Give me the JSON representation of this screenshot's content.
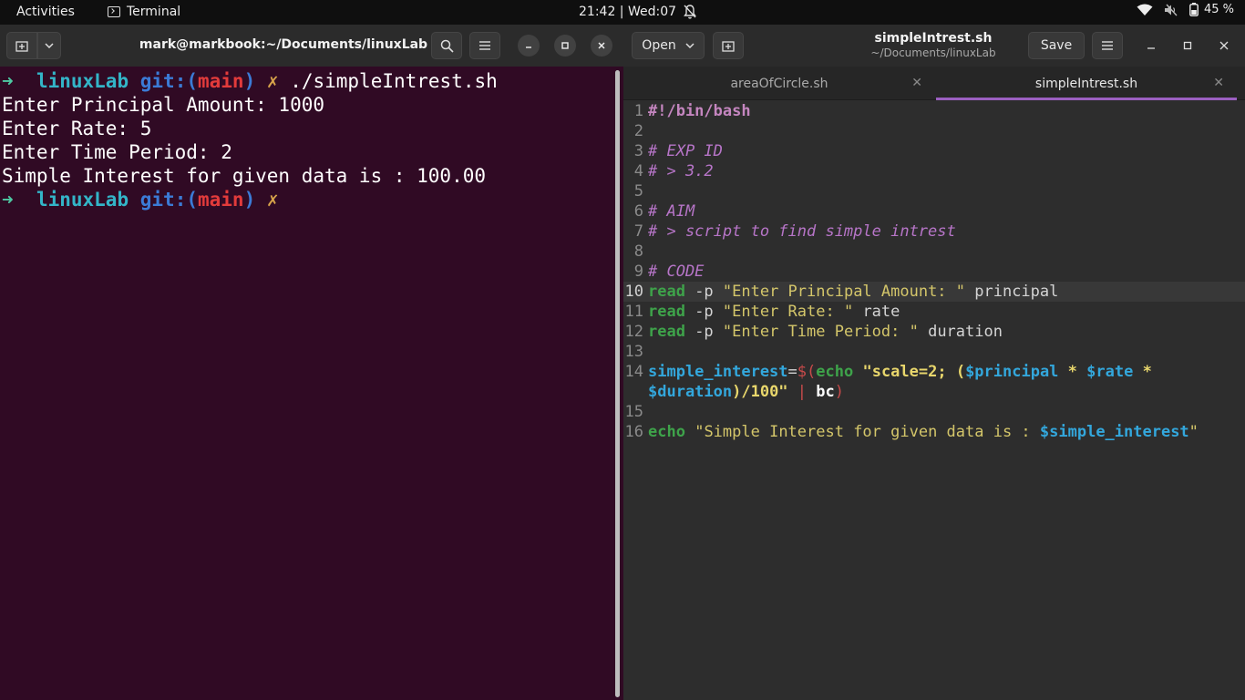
{
  "topbar": {
    "activities": "Activities",
    "app_name": "Terminal",
    "clock": "21:42 | Wed:07",
    "battery": "45 %"
  },
  "terminal": {
    "title": "mark@markbook:~/Documents/linuxLab",
    "prompt": {
      "arrow": "➜",
      "dir": "linuxLab",
      "git_prefix": "git:(",
      "branch": "main",
      "git_suffix": ")",
      "dirty": "✗"
    },
    "command": "./simpleIntrest.sh",
    "output": [
      "Enter Principal Amount: 1000",
      "Enter Rate: 5",
      "Enter Time Period: 2",
      "Simple Interest for given data is : 100.00"
    ]
  },
  "editor": {
    "open_label": "Open",
    "save_label": "Save",
    "title": "simpleIntrest.sh",
    "subtitle": "~/Documents/linuxLab",
    "tabs": [
      {
        "label": "areaOfCircle.sh",
        "active": false
      },
      {
        "label": "simpleIntrest.sh",
        "active": true
      }
    ],
    "code_lines": [
      {
        "n": "1",
        "parts": [
          [
            "shebang",
            "#!/bin/bash"
          ]
        ]
      },
      {
        "n": "2",
        "parts": []
      },
      {
        "n": "3",
        "parts": [
          [
            "comment",
            "# EXP ID"
          ]
        ]
      },
      {
        "n": "4",
        "parts": [
          [
            "comment",
            "# > 3.2"
          ]
        ]
      },
      {
        "n": "5",
        "parts": []
      },
      {
        "n": "6",
        "parts": [
          [
            "comment",
            "# AIM"
          ]
        ]
      },
      {
        "n": "7",
        "parts": [
          [
            "comment",
            "# > script to find simple intrest"
          ]
        ]
      },
      {
        "n": "8",
        "parts": []
      },
      {
        "n": "9",
        "parts": [
          [
            "comment",
            "# CODE"
          ]
        ]
      },
      {
        "n": "10",
        "current": true,
        "parts": [
          [
            "cmd",
            "read"
          ],
          [
            "plain",
            " -p "
          ],
          [
            "str",
            "\"Enter Principal Amount: \""
          ],
          [
            "plain",
            " principal"
          ]
        ]
      },
      {
        "n": "11",
        "parts": [
          [
            "cmd",
            "read"
          ],
          [
            "plain",
            " -p "
          ],
          [
            "str",
            "\"Enter Rate: \""
          ],
          [
            "plain",
            " rate"
          ]
        ]
      },
      {
        "n": "12",
        "parts": [
          [
            "cmd",
            "read"
          ],
          [
            "plain",
            " -p "
          ],
          [
            "str",
            "\"Enter Time Period: \""
          ],
          [
            "plain",
            " duration"
          ]
        ]
      },
      {
        "n": "13",
        "parts": []
      },
      {
        "n": "14",
        "wrap": true,
        "parts": [
          [
            "var",
            "simple_interest"
          ],
          [
            "plain",
            "="
          ],
          [
            "paren",
            "$("
          ],
          [
            "cmd",
            "echo"
          ],
          [
            "plain",
            " "
          ],
          [
            "strb",
            "\"scale=2; ("
          ],
          [
            "var",
            "$principal"
          ],
          [
            "strb",
            " * "
          ],
          [
            "var",
            "$rate"
          ],
          [
            "strb",
            " *\n"
          ],
          [
            "var",
            "$duration"
          ],
          [
            "strb",
            ")/100\""
          ],
          [
            "plain",
            " "
          ],
          [
            "paren",
            "|"
          ],
          [
            "plain",
            " "
          ],
          [
            "white",
            "bc"
          ],
          [
            "paren",
            ")"
          ]
        ]
      },
      {
        "n": "15",
        "parts": []
      },
      {
        "n": "16",
        "parts": [
          [
            "cmd",
            "echo"
          ],
          [
            "plain",
            " "
          ],
          [
            "str",
            "\"Simple Interest for given data is : "
          ],
          [
            "var",
            "$simple_interest"
          ],
          [
            "str",
            "\""
          ]
        ]
      }
    ]
  }
}
